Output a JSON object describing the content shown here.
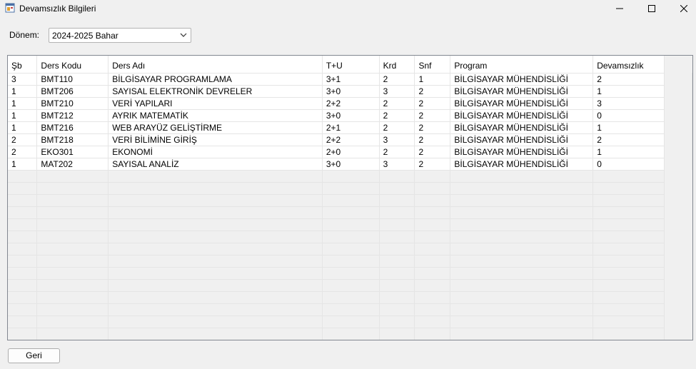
{
  "window": {
    "title": "Devamsızlık Bilgileri",
    "icon": "app-window-icon"
  },
  "filter": {
    "label": "Dönem:",
    "selected": "2024-2025 Bahar"
  },
  "grid": {
    "columns": [
      "Şb",
      "Ders Kodu",
      "Ders Adı",
      "T+U",
      "Krd",
      "Snf",
      "Program",
      "Devamsızlık"
    ],
    "rows": [
      [
        "3",
        "BMT110",
        "BİLGİSAYAR PROGRAMLAMA",
        "3+1",
        "2",
        "1",
        "BİLGİSAYAR MÜHENDİSLİĞİ",
        "2"
      ],
      [
        "1",
        "BMT206",
        "SAYISAL ELEKTRONİK DEVRELER",
        "3+0",
        "3",
        "2",
        "BİLGİSAYAR MÜHENDİSLİĞİ",
        "1"
      ],
      [
        "1",
        "BMT210",
        "VERİ YAPILARI",
        "2+2",
        "2",
        "2",
        "BİLGİSAYAR MÜHENDİSLİĞİ",
        "3"
      ],
      [
        "1",
        "BMT212",
        "AYRIK MATEMATİK",
        "3+0",
        "2",
        "2",
        "BİLGİSAYAR MÜHENDİSLİĞİ",
        "0"
      ],
      [
        "1",
        "BMT216",
        "WEB ARAYÜZ GELİŞTİRME",
        "2+1",
        "2",
        "2",
        "BİLGİSAYAR MÜHENDİSLİĞİ",
        "1"
      ],
      [
        "2",
        "BMT218",
        "VERİ BİLİMİNE GİRİŞ",
        "2+2",
        "3",
        "2",
        "BİLGİSAYAR MÜHENDİSLİĞİ",
        "2"
      ],
      [
        "2",
        "EKO301",
        "EKONOMİ",
        "2+0",
        "2",
        "2",
        "BİLGİSAYAR MÜHENDİSLİĞİ",
        "1"
      ],
      [
        "1",
        "MAT202",
        "SAYISAL ANALİZ",
        "3+0",
        "3",
        "2",
        "BİLGİSAYAR MÜHENDİSLİĞİ",
        "0"
      ]
    ]
  },
  "actions": {
    "back_label": "Geri"
  }
}
